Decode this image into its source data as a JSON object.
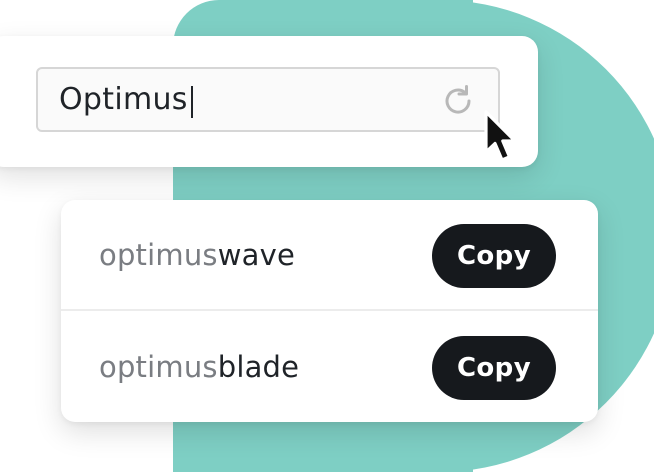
{
  "colors": {
    "accent_teal": "#7ecfc4",
    "button_bg": "#16191d",
    "prefix_text": "#7a7d82",
    "suffix_text": "#1f2328"
  },
  "search": {
    "value": "Optimus",
    "refresh_icon": "refresh-icon",
    "cursor_icon": "cursor-arrow-icon"
  },
  "results": [
    {
      "prefix": "optimus",
      "suffix": "wave",
      "copy_label": "Copy"
    },
    {
      "prefix": "optimus",
      "suffix": "blade",
      "copy_label": "Copy"
    }
  ]
}
